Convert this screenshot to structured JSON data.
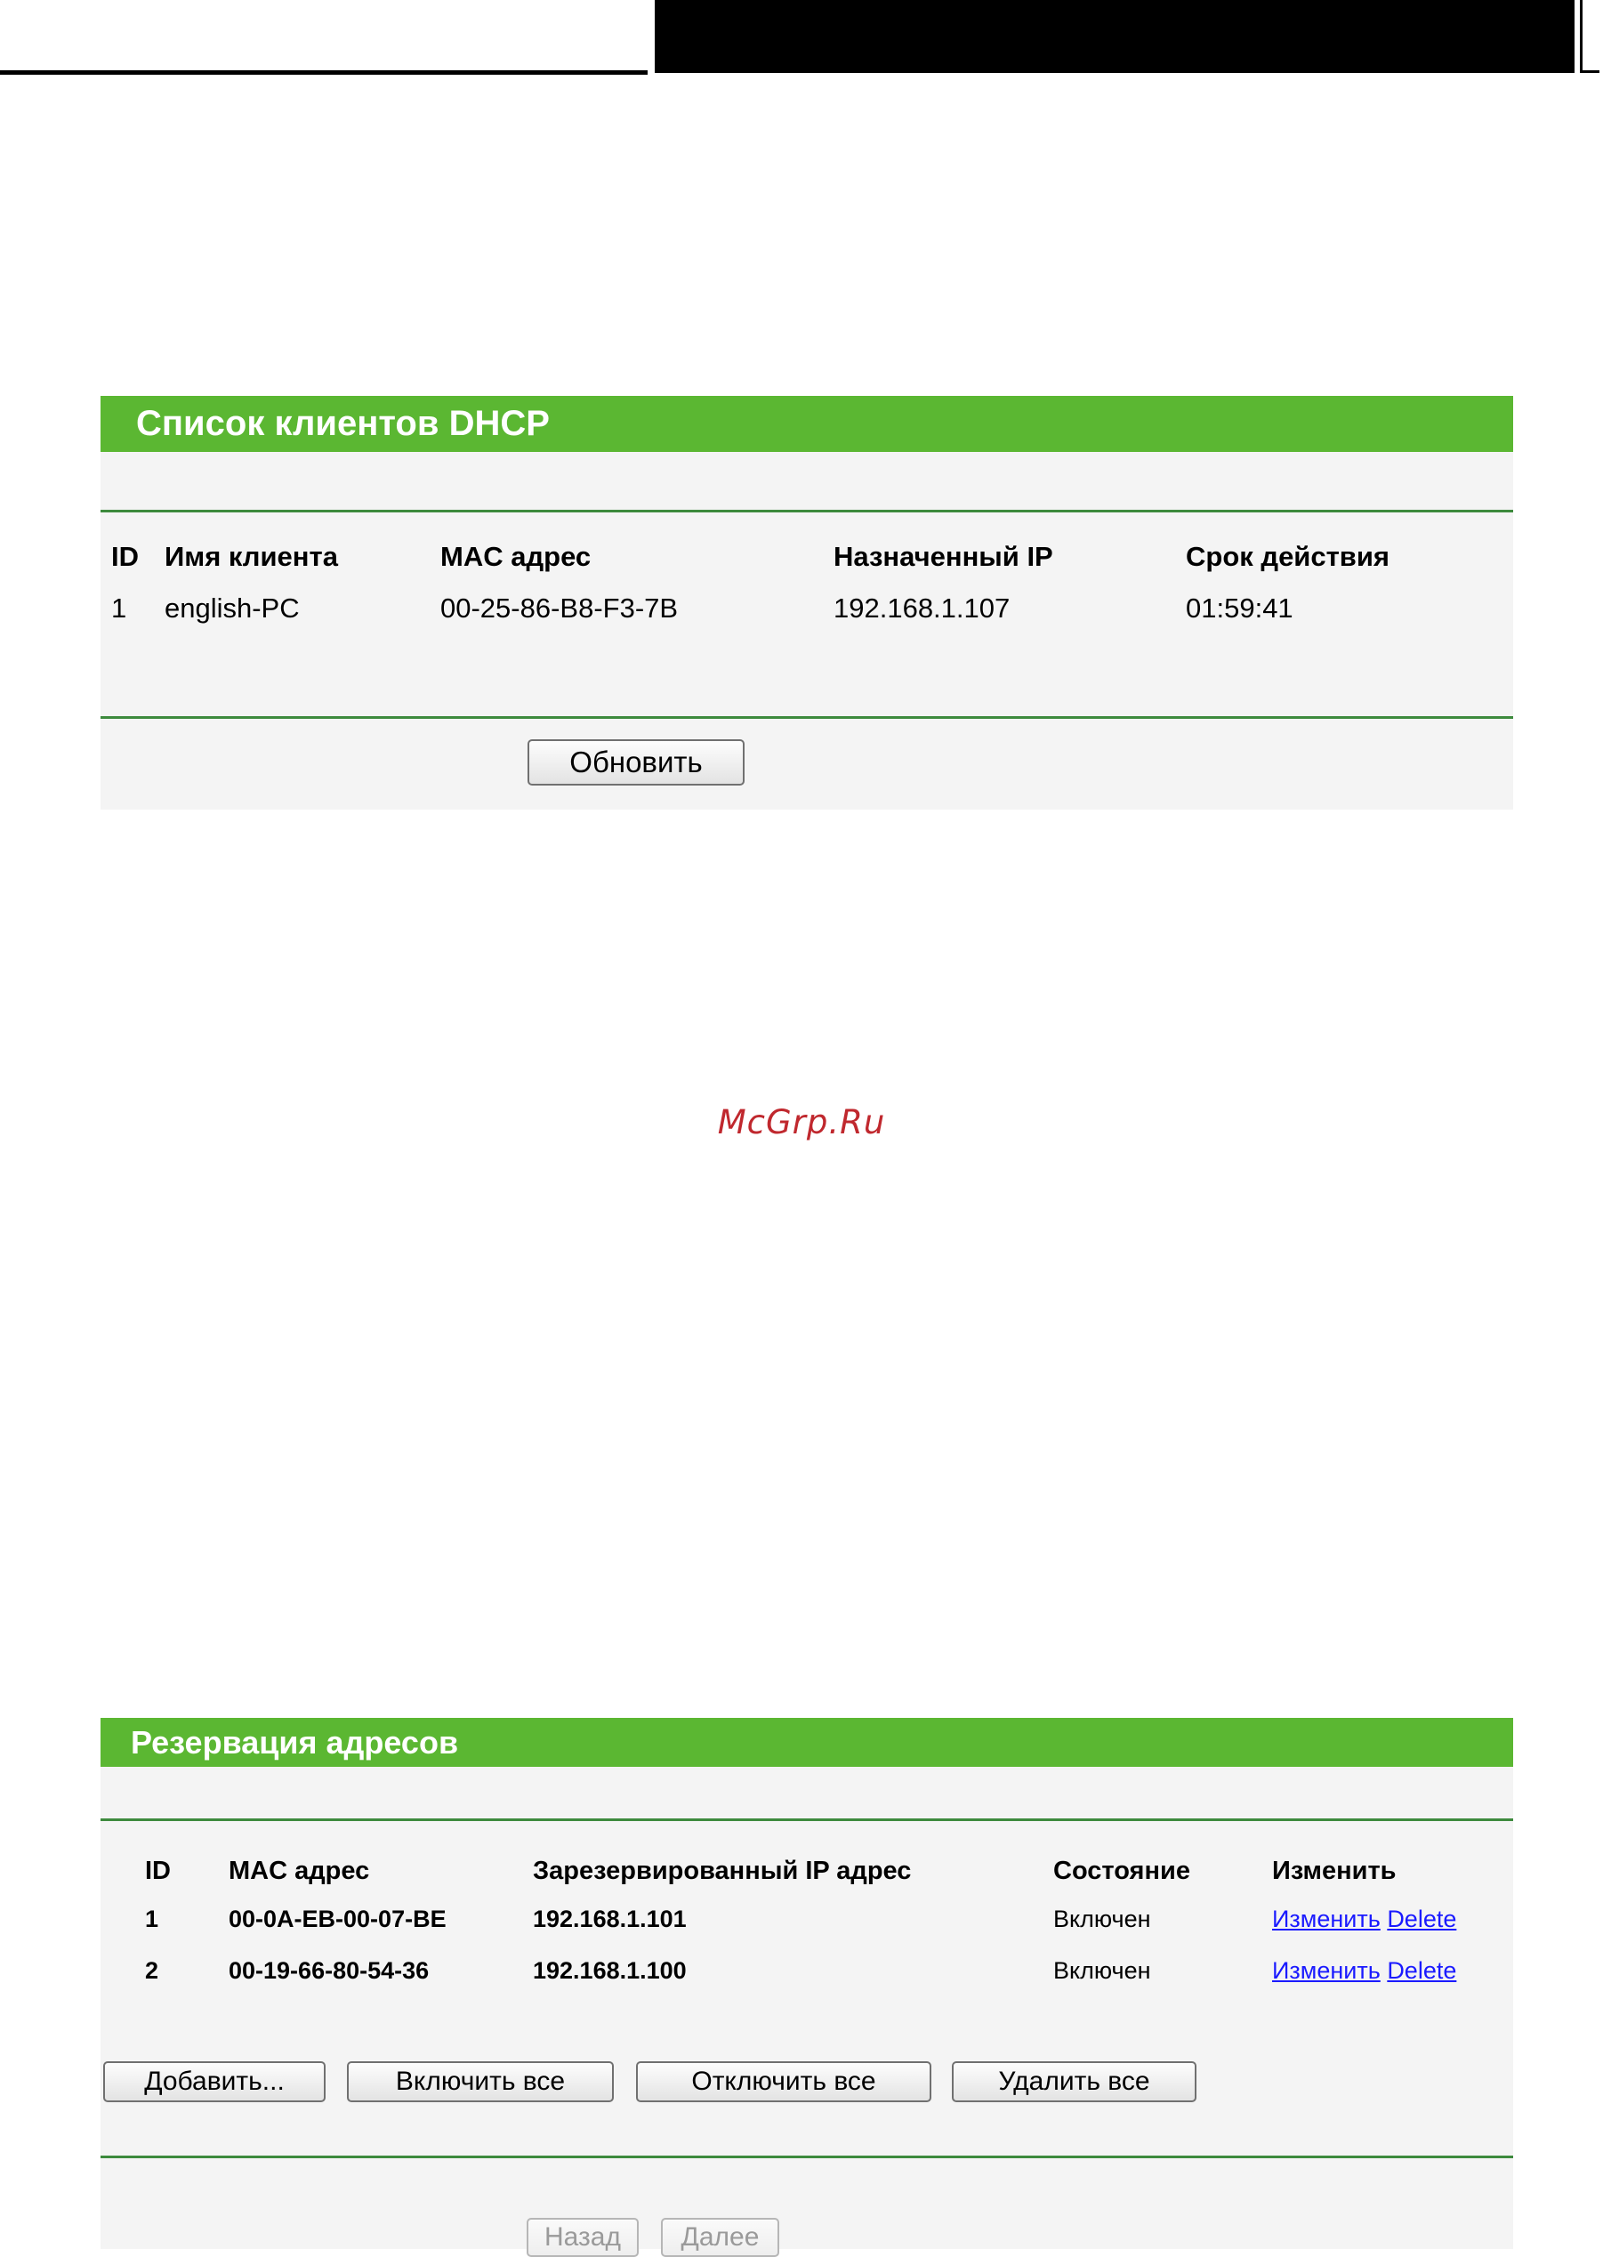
{
  "dhcp_clients": {
    "title": "Список клиентов DHCP",
    "columns": [
      "ID",
      "Имя клиента",
      "MAC адрес",
      "Назначенный IP",
      "Срок действия"
    ],
    "rows": [
      {
        "id": "1",
        "name": "english-PC",
        "mac": "00-25-86-B8-F3-7B",
        "ip": "192.168.1.107",
        "lease": "01:59:41"
      }
    ],
    "refresh_label": "Обновить"
  },
  "watermark": "McGrp.Ru",
  "address_reservation": {
    "title": "Резервация адресов",
    "columns": [
      "ID",
      "MAC адрес",
      "Зарезервированный IP адрес",
      "Состояние",
      "Изменить"
    ],
    "rows": [
      {
        "id": "1",
        "mac": "00-0A-EB-00-07-BE",
        "ip": "192.168.1.101",
        "state": "Включен",
        "edit": "Изменить",
        "delete": "Delete"
      },
      {
        "id": "2",
        "mac": "00-19-66-80-54-36",
        "ip": "192.168.1.100",
        "state": "Включен",
        "edit": "Изменить",
        "delete": "Delete"
      }
    ],
    "buttons": {
      "add": "Добавить...",
      "enable_all": "Включить все",
      "disable_all": "Отключить все",
      "delete_all": "Удалить все",
      "back": "Назад",
      "next": "Далее"
    }
  }
}
